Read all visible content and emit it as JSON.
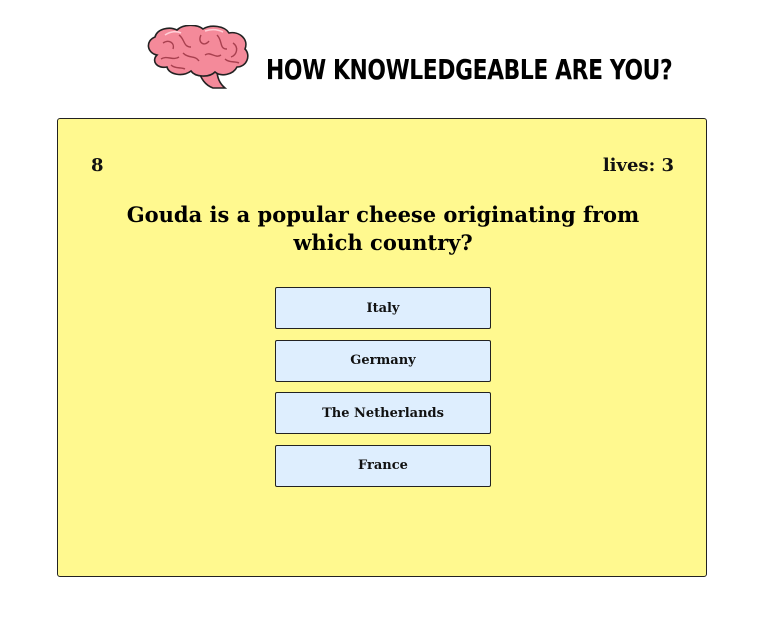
{
  "header": {
    "title": "How knowledgeable are you?",
    "logo_icon": "brain-icon"
  },
  "game": {
    "score": "8",
    "lives": "lives: 3",
    "question": "Gouda is a popular cheese originating from which country?",
    "answers": [
      "Italy",
      "Germany",
      "The Netherlands",
      "France"
    ]
  },
  "colors": {
    "card_background": "#fff98f",
    "answer_background": "#deeefe",
    "brain_pink": "#f48a9a"
  }
}
